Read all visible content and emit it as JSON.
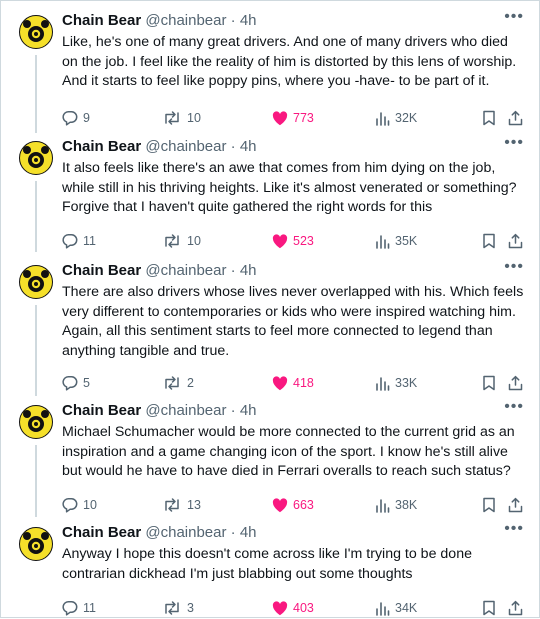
{
  "colors": {
    "like": "#f91880",
    "muted": "#536471",
    "text": "#0f1419"
  },
  "tweets": [
    {
      "name": "Chain Bear",
      "handle": "@chainbear",
      "time": "4h",
      "text": "Like, he's one of many great drivers. And one of many drivers who died on the job. I feel like the reality of him is distorted by this lens of worship. And it starts to feel like poppy pins, where you -have- to be part of it.",
      "replies": "9",
      "retweets": "10",
      "likes": "773",
      "views": "32K"
    },
    {
      "name": "Chain Bear",
      "handle": "@chainbear",
      "time": "4h",
      "text": "It also feels like there's an awe that comes from him dying on the job, while still in his thriving heights. Like it's almost venerated or something? Forgive that I haven't quite gathered the right words for this",
      "replies": "11",
      "retweets": "10",
      "likes": "523",
      "views": "35K"
    },
    {
      "name": "Chain Bear",
      "handle": "@chainbear",
      "time": "4h",
      "text": "There are also drivers whose lives never overlapped with his. Which feels very different to contemporaries or kids who were inspired watching him. Again, all this sentiment starts to feel more connected to legend than anything tangible and true.",
      "replies": "5",
      "retweets": "2",
      "likes": "418",
      "views": "33K"
    },
    {
      "name": "Chain Bear",
      "handle": "@chainbear",
      "time": "4h",
      "text": "Michael Schumacher would be more connected to the current grid as an inspiration and a game changing icon of the sport. I know he's still alive but would he have to have died in Ferrari overalls to reach such status?",
      "replies": "10",
      "retweets": "13",
      "likes": "663",
      "views": "38K"
    },
    {
      "name": "Chain Bear",
      "handle": "@chainbear",
      "time": "4h",
      "text": "Anyway I hope this doesn't come across like I'm trying to be done contrarian dickhead I'm just blabbing out some thoughts",
      "replies": "11",
      "retweets": "3",
      "likes": "403",
      "views": "34K"
    }
  ]
}
